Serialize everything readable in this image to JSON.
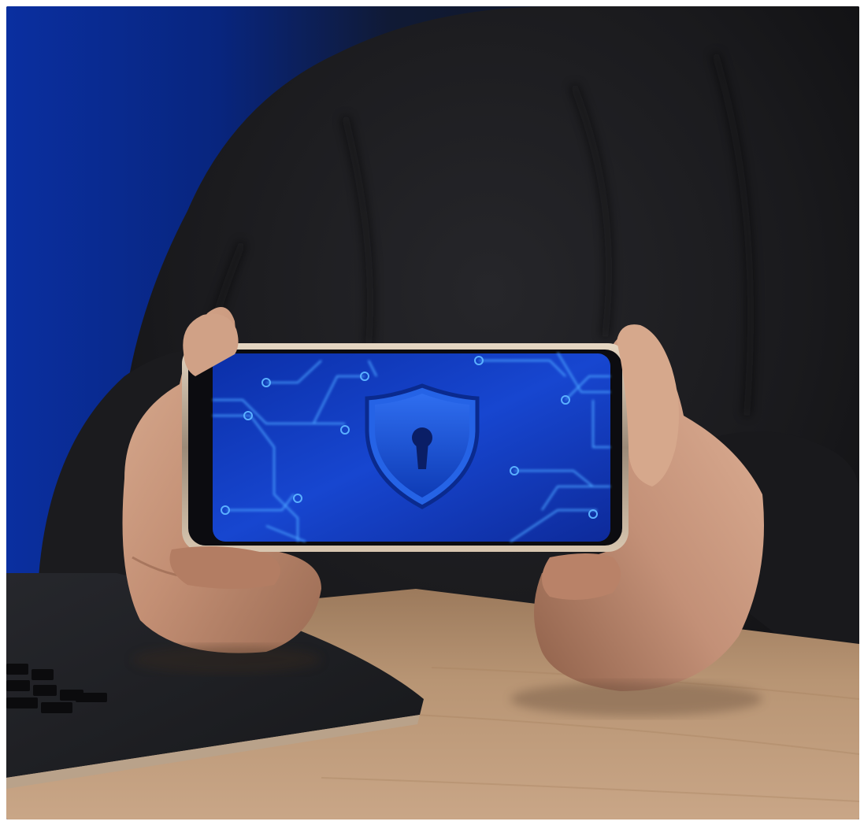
{
  "scene": {
    "subject": "person-holding-smartphone",
    "screen_icon": "shield-keyhole-icon",
    "colors": {
      "backdrop_blue": "#0a2a8a",
      "sweater": "#1a1a1c",
      "desk_wood": "#b8936e",
      "screen_blue": "#1d4fd6",
      "circuit_line": "#3b8cff",
      "laptop": "#1b1c20",
      "phone_frame": "#c9b8a4"
    }
  }
}
